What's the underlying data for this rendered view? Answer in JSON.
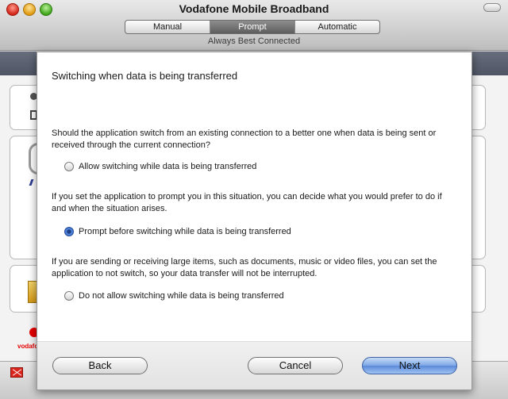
{
  "window": {
    "title": "Vodafone Mobile Broadband",
    "subtitle": "Always Best Connected",
    "modes": [
      {
        "label": "Manual",
        "selected": false
      },
      {
        "label": "Prompt",
        "selected": true
      },
      {
        "label": "Automatic",
        "selected": false
      }
    ]
  },
  "background": {
    "brand_text": "vodafone",
    "brand_color": "#e60000"
  },
  "dialog": {
    "title": "Switching when data is being transferred",
    "paragraphs": [
      "Should the application switch from an existing connection to a better one when data is being sent or received through the current connection?",
      "If you set the application to prompt you in this situation, you can decide what you would prefer to do if and when the situation arises.",
      "If you are sending or receiving large items, such as documents, music or video files, you can set the application to not switch, so your data transfer will not be interrupted."
    ],
    "options": [
      {
        "label": "Allow switching while data is being transferred",
        "checked": false
      },
      {
        "label": "Prompt before switching while data is being transferred",
        "checked": true
      },
      {
        "label": "Do not allow switching while data is being transferred",
        "checked": false
      }
    ],
    "buttons": {
      "back": "Back",
      "cancel": "Cancel",
      "next": "Next"
    }
  }
}
